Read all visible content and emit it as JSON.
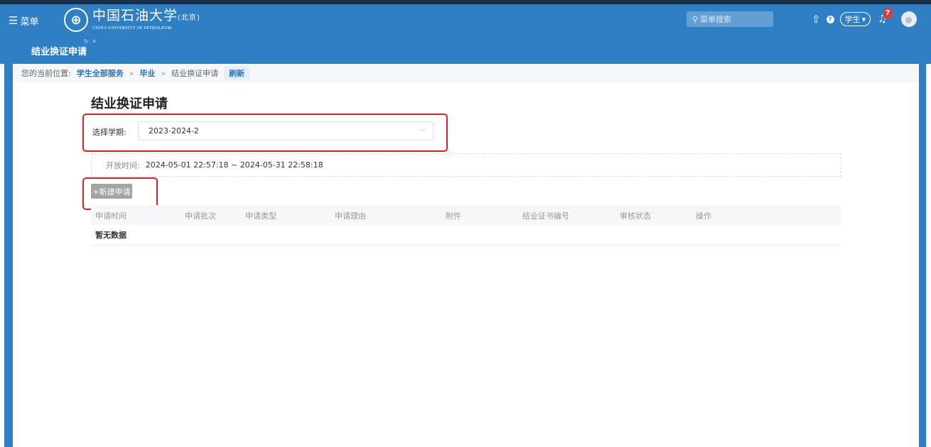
{
  "header": {
    "menu_label": "菜单",
    "logo_cn": "中国石油大学",
    "logo_cn_suffix": "(北京)",
    "logo_en": "CHINA UNIVERSITY OF PETROLEUM",
    "search_placeholder": "菜单搜索",
    "role_label": "学生",
    "notification_count": "7"
  },
  "tabs": {
    "active_label": "结业换证申请"
  },
  "breadcrumb": {
    "prefix": "您的当前位置:",
    "items": [
      "学生全部服务",
      "毕业",
      "结业换证申请"
    ],
    "separator": "»",
    "refresh_label": "刷新"
  },
  "main": {
    "title": "结业换证申请",
    "semester_label": "选择学期:",
    "semester_value": "2023-2024-2",
    "open_time_label": "开放时间:",
    "open_time_value": "2024-05-01 22:57:18 ~ 2024-05-31 22:58:18",
    "new_button_label": "+新建申请",
    "table": {
      "columns": [
        "申请时间",
        "申请批次",
        "申请类型",
        "申请理由",
        "附件",
        "结业证书编号",
        "审核状态",
        "操作"
      ],
      "empty_text": "暂无数据"
    }
  },
  "colors": {
    "primary": "#2f7fc5",
    "highlight": "#e02020",
    "badge": "#e8332f"
  }
}
